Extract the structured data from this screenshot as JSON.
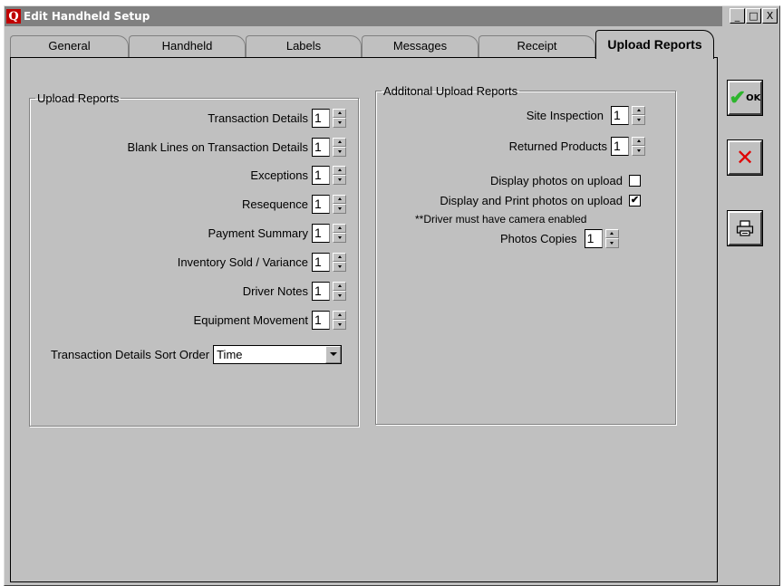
{
  "window": {
    "app_icon_letter": "Q",
    "title": "Edit Handheld Setup",
    "controls": [
      "_",
      "□",
      "X"
    ]
  },
  "tabs": [
    {
      "label": "General"
    },
    {
      "label": "Handheld"
    },
    {
      "label": "Labels"
    },
    {
      "label": "Messages"
    },
    {
      "label": "Receipt"
    },
    {
      "label": "Upload Reports",
      "active": true
    }
  ],
  "upload_reports": {
    "legend": "Upload Reports",
    "rows": [
      {
        "label": "Transaction Details",
        "value": "1"
      },
      {
        "label": "Blank Lines on Transaction Details",
        "value": "1"
      },
      {
        "label": "Exceptions",
        "value": "1"
      },
      {
        "label": "Resequence",
        "value": "1"
      },
      {
        "label": "Payment Summary",
        "value": "1"
      },
      {
        "label": "Inventory Sold / Variance",
        "value": "1"
      },
      {
        "label": "Driver Notes",
        "value": "1"
      },
      {
        "label": "Equipment Movement",
        "value": "1"
      }
    ],
    "sort_order_label": "Transaction Details Sort Order",
    "sort_order_value": "Time"
  },
  "additional_reports": {
    "legend": "Additonal Upload Reports",
    "site_inspection_label": "Site Inspection",
    "site_inspection_value": "1",
    "returned_products_label": "Returned Products",
    "returned_products_value": "1",
    "display_photos_label": "Display photos on upload",
    "display_photos_checked": false,
    "display_print_photos_label": "Display and Print photos on upload",
    "display_print_photos_checked": true,
    "camera_note": "**Driver must have camera enabled",
    "photo_copies_label": "Photos Copies",
    "photo_copies_value": "1"
  },
  "side_buttons": {
    "ok_label": "OK",
    "ok_icon": "check-icon",
    "cancel_icon": "x-icon",
    "print_icon": "printer-icon"
  },
  "colors": {
    "titlebar": "#808080",
    "ok_check": "#2db52d",
    "cancel_x": "#e00000",
    "app_icon": "#c00000"
  }
}
